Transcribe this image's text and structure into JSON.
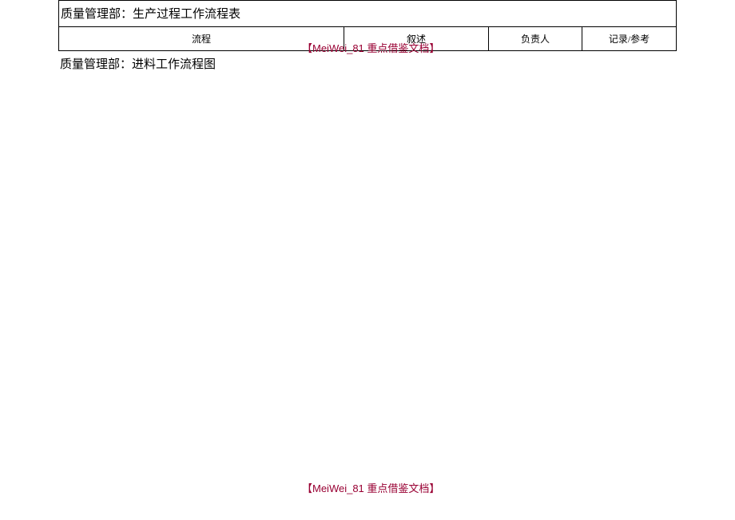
{
  "table": {
    "title": "质量管理部：生产过程工作流程表",
    "headers": {
      "process": "流程",
      "description": "叙述",
      "owner": "负责人",
      "record": "记录/参考"
    }
  },
  "sub_heading": "质量管理部：进料工作流程图",
  "watermark": "【MeiWei_81 重点借鉴文档】"
}
